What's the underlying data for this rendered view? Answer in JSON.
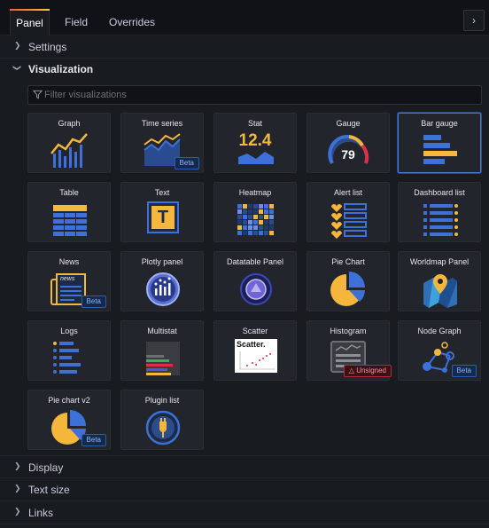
{
  "tabs": [
    {
      "label": "Panel",
      "active": true
    },
    {
      "label": "Field",
      "active": false
    },
    {
      "label": "Overrides",
      "active": false
    }
  ],
  "collapse_icon": "chevron-right-icon",
  "sections": {
    "settings": "Settings",
    "visualization": "Visualization",
    "display": "Display",
    "text_size": "Text size",
    "links": "Links"
  },
  "filter": {
    "placeholder": "Filter visualizations",
    "value": ""
  },
  "visualizations": [
    {
      "name": "Graph",
      "icon": "graph-icon"
    },
    {
      "name": "Time series",
      "icon": "time-series-icon",
      "badge": "Beta"
    },
    {
      "name": "Stat",
      "icon": "stat-icon",
      "value": "12.4"
    },
    {
      "name": "Gauge",
      "icon": "gauge-icon",
      "value": "79"
    },
    {
      "name": "Bar gauge",
      "icon": "bar-gauge-icon",
      "selected": true
    },
    {
      "name": "Table",
      "icon": "table-icon"
    },
    {
      "name": "Text",
      "icon": "text-icon",
      "letter": "T"
    },
    {
      "name": "Heatmap",
      "icon": "heatmap-icon"
    },
    {
      "name": "Alert list",
      "icon": "alert-list-icon"
    },
    {
      "name": "Dashboard list",
      "icon": "dashboard-list-icon"
    },
    {
      "name": "News",
      "icon": "news-icon",
      "badge": "Beta",
      "label": "news"
    },
    {
      "name": "Plotly panel",
      "icon": "plotly-icon"
    },
    {
      "name": "Datatable Panel",
      "icon": "datatable-icon"
    },
    {
      "name": "Pie Chart",
      "icon": "pie-chart-icon"
    },
    {
      "name": "Worldmap Panel",
      "icon": "worldmap-icon"
    },
    {
      "name": "Logs",
      "icon": "logs-icon"
    },
    {
      "name": "Multistat",
      "icon": "multistat-icon"
    },
    {
      "name": "Scatter",
      "icon": "scatter-icon",
      "label": "Scatter."
    },
    {
      "name": "Histogram",
      "icon": "histogram-icon",
      "badge": "Unsigned"
    },
    {
      "name": "Node Graph",
      "icon": "node-graph-icon",
      "badge": "Beta"
    },
    {
      "name": "Pie chart v2",
      "icon": "pie-chart-v2-icon",
      "badge": "Beta"
    },
    {
      "name": "Plugin list",
      "icon": "plugin-list-icon"
    }
  ],
  "colors": {
    "accent": "#4b77d6",
    "yellow": "#f5b73b",
    "blue": "#3d71d9",
    "red": "#e02f44"
  }
}
